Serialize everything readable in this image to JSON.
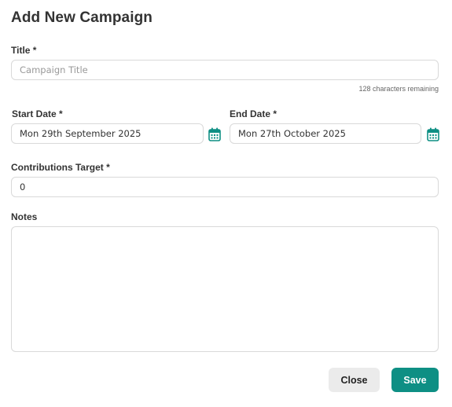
{
  "dialog": {
    "title": "Add New Campaign",
    "accent_color": "#0e8f84"
  },
  "fields": {
    "title": {
      "label": "Title *",
      "placeholder": "Campaign Title",
      "value": "",
      "remaining": "128 characters remaining"
    },
    "start_date": {
      "label": "Start Date *",
      "value": "Mon 29th September 2025",
      "icon": "calendar-icon"
    },
    "end_date": {
      "label": "End Date *",
      "value": "Mon 27th October 2025",
      "icon": "calendar-icon"
    },
    "contributions_target": {
      "label": "Contributions Target *",
      "value": "0"
    },
    "notes": {
      "label": "Notes",
      "value": ""
    }
  },
  "actions": {
    "close_label": "Close",
    "save_label": "Save"
  }
}
